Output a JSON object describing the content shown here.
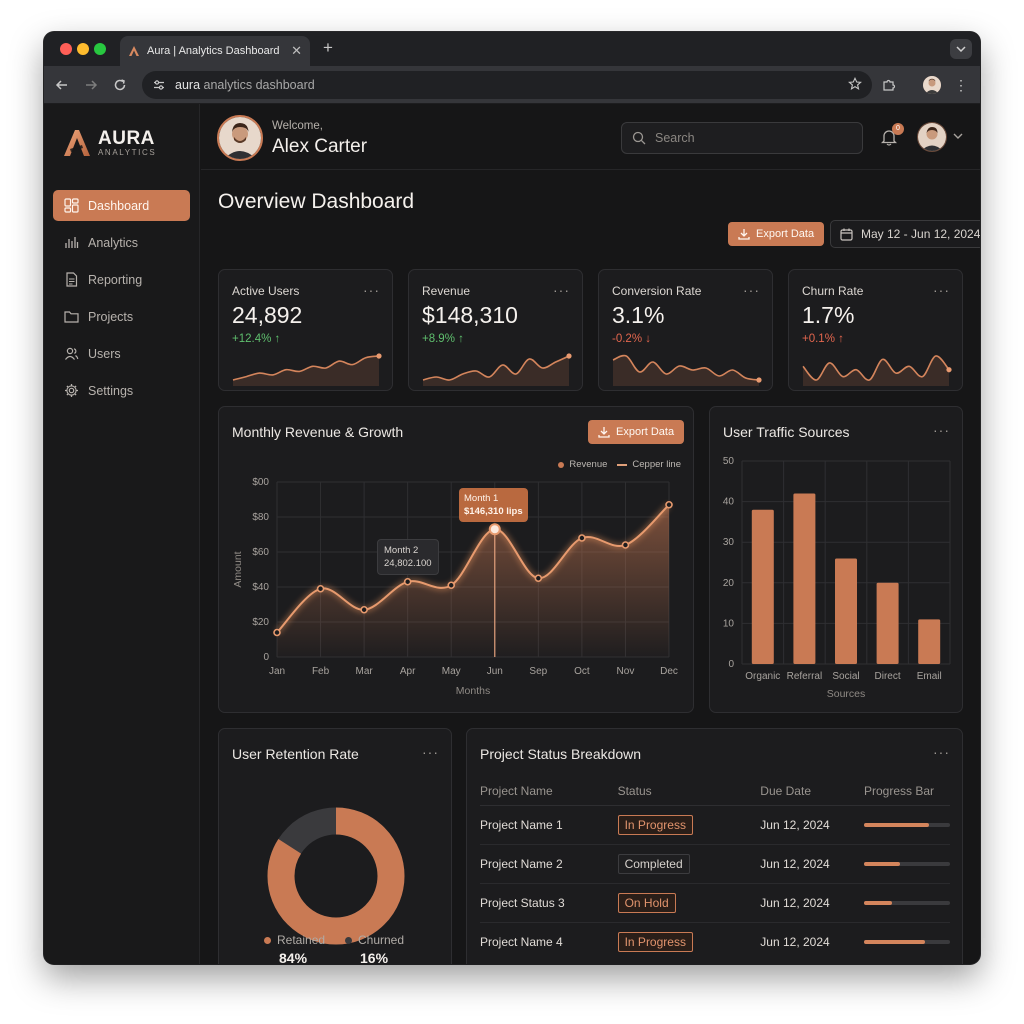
{
  "browser": {
    "tab_title": "Aura | Analytics Dashboard",
    "url_domain": "aura",
    "url_rest": " analytics dashboard"
  },
  "sidebar": {
    "brand": "AURA",
    "brand_sub": "ANALYTICS",
    "items": [
      {
        "label": "Dashboard",
        "icon": "grid-icon",
        "active": true
      },
      {
        "label": "Analytics",
        "icon": "bar-chart-icon",
        "active": false
      },
      {
        "label": "Reporting",
        "icon": "document-icon",
        "active": false
      },
      {
        "label": "Projects",
        "icon": "folder-icon",
        "active": false
      },
      {
        "label": "Users",
        "icon": "users-icon",
        "active": false
      },
      {
        "label": "Settings",
        "icon": "gear-icon",
        "active": false
      }
    ]
  },
  "header": {
    "welcome": "Welcome,",
    "user_name": "Alex Carter",
    "search_placeholder": "Search",
    "notification_count": "0"
  },
  "page": {
    "title": "Overview Dashboard",
    "export_label": "Export Data",
    "date_range": "May 12 - Jun 12, 2024"
  },
  "kpis": [
    {
      "label": "Active Users",
      "value": "24,892",
      "delta": "+12.4%",
      "trend": "up",
      "good": true,
      "spark": [
        10,
        12,
        14,
        13,
        16,
        15,
        18,
        17,
        21,
        19,
        23,
        24
      ]
    },
    {
      "label": "Revenue",
      "value": "$148,310",
      "delta": "+8.9%",
      "trend": "up",
      "good": true,
      "spark": [
        12,
        13,
        12,
        14,
        15,
        13,
        17,
        14,
        19,
        16,
        18,
        20
      ]
    },
    {
      "label": "Conversion Rate",
      "value": "3.1%",
      "delta": "-0.2%",
      "trend": "down",
      "good": false,
      "spark": [
        22,
        24,
        16,
        21,
        15,
        19,
        17,
        18,
        14,
        17,
        13,
        12
      ]
    },
    {
      "label": "Churn Rate",
      "value": "1.7%",
      "delta": "+0.1%",
      "trend": "up",
      "good": false,
      "spark": [
        20,
        16,
        21,
        17,
        19,
        16,
        22,
        18,
        20,
        17,
        23,
        19
      ]
    }
  ],
  "revenue_chart": {
    "title": "Monthly Revenue & Growth",
    "export_label": "Export Data",
    "legend": [
      "Revenue",
      "Cepper line"
    ],
    "tooltip1": {
      "title": "Month 1",
      "value": "$146,310 lips"
    },
    "tooltip2": {
      "title": "Month 2",
      "value": "24,802.100"
    }
  },
  "traffic_chart": {
    "title": "User Traffic Sources"
  },
  "retention": {
    "title": "User Retention Rate",
    "retained_label": "Retained",
    "retained_value": "84%",
    "churned_label": "Churned",
    "churned_value": "16%"
  },
  "projects": {
    "title": "Project Status Breakdown",
    "columns": [
      "Project Name",
      "Status",
      "Due Date",
      "Progress Bar"
    ],
    "rows": [
      {
        "name": "Project Name 1",
        "status": "In Progress",
        "highlight": true,
        "due": "Jun 12, 2024",
        "progress": 0.75
      },
      {
        "name": "Project Name 2",
        "status": "Completed",
        "highlight": false,
        "due": "Jun 12, 2024",
        "progress": 0.42
      },
      {
        "name": "Project Status 3",
        "status": "On Hold",
        "highlight": true,
        "due": "Jun 12, 2024",
        "progress": 0.33
      },
      {
        "name": "Project Name 4",
        "status": "In Progress",
        "highlight": true,
        "due": "Jun 12, 2024",
        "progress": 0.71
      }
    ]
  },
  "colors": {
    "accent": "#c97a54",
    "background": "#161617",
    "card": "#1c1c1e",
    "positive": "#5fbf6e",
    "negative": "#e2664e"
  },
  "chart_data": [
    {
      "type": "line",
      "title": "Monthly Revenue & Growth",
      "xlabel": "Months",
      "ylabel": "Amount",
      "categories": [
        "Jan",
        "Feb",
        "Mar",
        "Apr",
        "May",
        "Jun",
        "Sep",
        "Oct",
        "Nov",
        "Dec"
      ],
      "y_tick_labels": [
        "0",
        "$20",
        "$40",
        "$60",
        "$80",
        "$00"
      ],
      "ylim": [
        0,
        100
      ],
      "series": [
        {
          "name": "Revenue",
          "values": [
            14,
            39,
            27,
            43,
            41,
            73,
            45,
            68,
            64,
            87
          ]
        }
      ],
      "grid": true,
      "legend": "top-right"
    },
    {
      "type": "bar",
      "title": "User Traffic Sources",
      "xlabel": "Sources",
      "ylabel": "",
      "categories": [
        "Organic",
        "Referral",
        "Social",
        "Direct",
        "Email"
      ],
      "values": [
        38,
        42,
        26,
        20,
        11
      ],
      "ylim": [
        0,
        50
      ],
      "y_ticks": [
        0,
        10,
        20,
        30,
        40,
        50
      ],
      "grid": true
    },
    {
      "type": "pie",
      "title": "User Retention Rate",
      "categories": [
        "Retained",
        "Churned"
      ],
      "values": [
        84,
        16
      ]
    }
  ]
}
